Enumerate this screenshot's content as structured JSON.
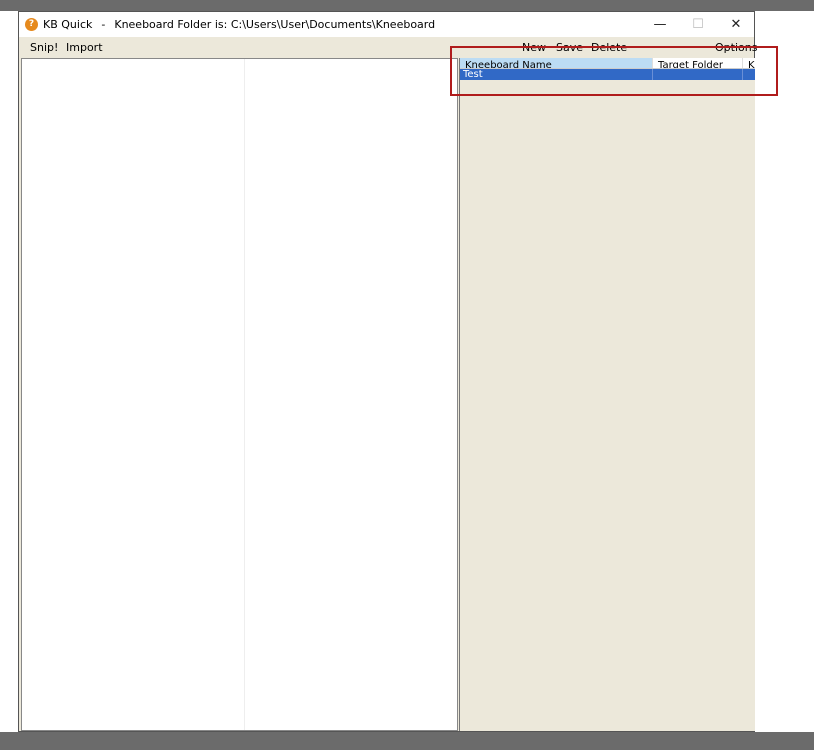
{
  "window": {
    "app_name": "KB Quick",
    "separator": "-",
    "folder_text": "Kneeboard Folder is: C:\\Users\\User\\Documents\\Kneeboard",
    "minimize": "—",
    "maximize": "☐",
    "close": "✕"
  },
  "menu": {
    "snip": "Snip!",
    "import": "Import",
    "new": "New",
    "save": "Save",
    "delete": "Delete",
    "options": "Options"
  },
  "table": {
    "columns": [
      "Kneeboard Name",
      "Target Folder",
      "Kl"
    ],
    "rows": [
      {
        "name": "Test",
        "folder": "",
        "extra": ""
      }
    ]
  }
}
